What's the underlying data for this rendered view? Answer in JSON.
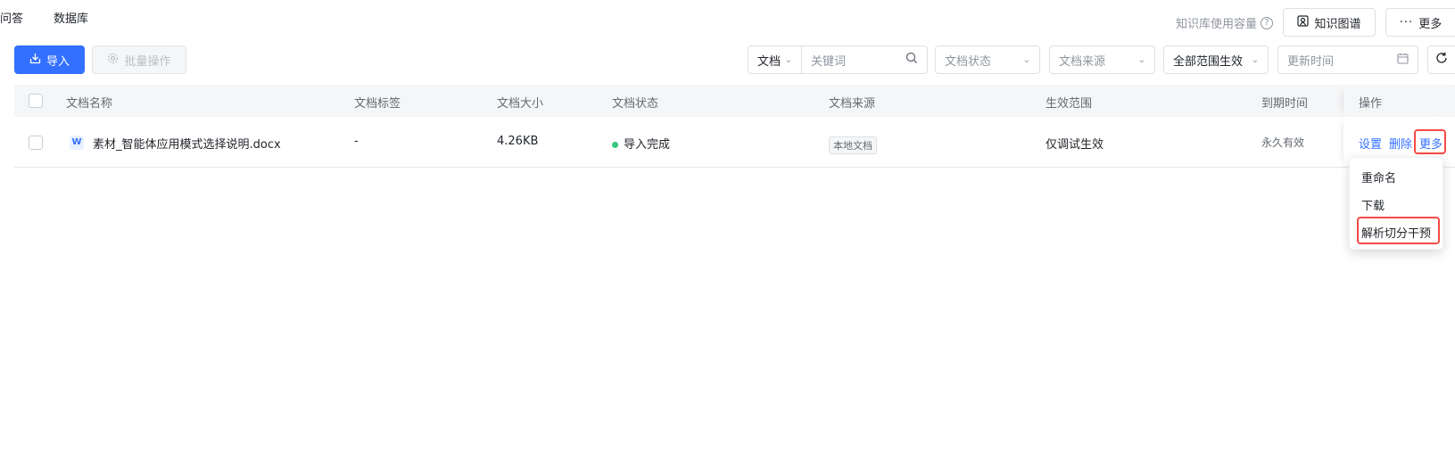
{
  "tabs": {
    "qa": "问答",
    "database": "数据库"
  },
  "topbar": {
    "capacity_label": "知识库使用容量",
    "help_glyph": "?",
    "knowledge_graph_button": "知识图谱",
    "more_button": "更多"
  },
  "toolbar": {
    "import_button": "导入",
    "batch_button": "批量操作"
  },
  "filters": {
    "doc_type": "文档",
    "keyword_placeholder": "关键词",
    "status_placeholder": "文档状态",
    "source_placeholder": "文档来源",
    "scope_value": "全部范围生效",
    "time_placeholder": "更新时间"
  },
  "table": {
    "columns": {
      "name": "文档名称",
      "tags": "文档标签",
      "size": "文档大小",
      "status": "文档状态",
      "source": "文档来源",
      "scope": "生效范围",
      "expiry": "到期时间",
      "actions": "操作"
    },
    "rows": [
      {
        "name": "素材_智能体应用模式选择说明.docx",
        "tags": "-",
        "size": "4.26KB",
        "status": "导入完成",
        "source": "本地文档",
        "scope": "仅调试生效",
        "expiry": "永久有效",
        "actions": {
          "settings": "设置",
          "delete": "删除",
          "more": "更多"
        }
      }
    ]
  },
  "dropdown": {
    "items": [
      "重命名",
      "下载",
      "解析切分干预"
    ]
  },
  "colors": {
    "primary": "#3370ff",
    "success": "#34c77b",
    "highlight": "#f54a45"
  }
}
